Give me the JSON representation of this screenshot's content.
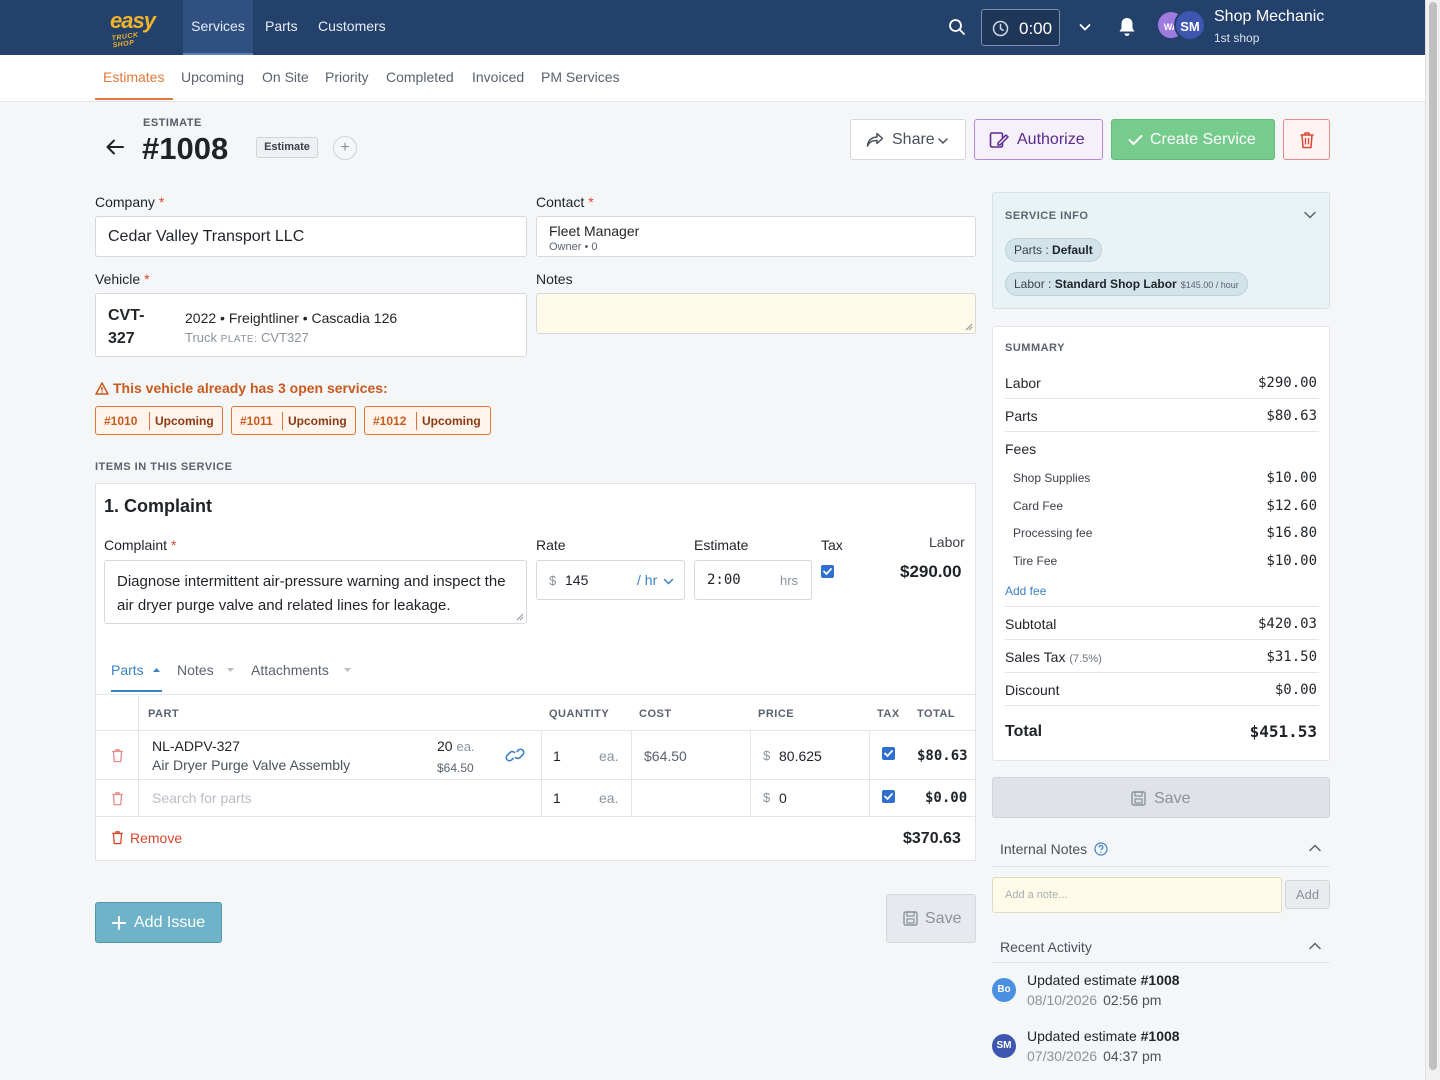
{
  "topnav": {
    "logo_line1": "easy",
    "logo_line2": "TRUCK SHOP",
    "tabs": [
      "Services",
      "Parts",
      "Customers"
    ],
    "timer": "0:00",
    "user": {
      "initials_a": "WA",
      "initials_b": "SM",
      "name": "Shop Mechanic",
      "shop": "1st shop"
    }
  },
  "subnav": {
    "tabs": [
      "Estimates",
      "Upcoming",
      "On Site",
      "Priority",
      "Completed",
      "Invoiced",
      "PM Services"
    ],
    "active": "Estimates"
  },
  "header": {
    "kicker": "ESTIMATE",
    "number": "#1008",
    "badge": "Estimate",
    "plus": "+",
    "share_label": "Share",
    "authorize_label": "Authorize",
    "create_label": "Create Service"
  },
  "form": {
    "company_label": "Company",
    "company_value": "Cedar Valley Transport LLC",
    "contact_label": "Contact",
    "contact_name": "Fleet Manager",
    "contact_sub": "Owner • 0",
    "vehicle_label": "Vehicle",
    "vehicle_id": "CVT-327",
    "vehicle_desc": "2022 • Freightliner • Cascadia 126",
    "vehicle_type": "Truck",
    "vehicle_plate_label": "PLATE:",
    "vehicle_plate": "CVT327",
    "notes_label": "Notes",
    "notes_value": "",
    "required_mark": "*"
  },
  "warning": {
    "text": "This vehicle already has 3 open services:",
    "services": [
      {
        "number": "#1010",
        "status": "Upcoming"
      },
      {
        "number": "#1011",
        "status": "Upcoming"
      },
      {
        "number": "#1012",
        "status": "Upcoming"
      }
    ]
  },
  "items": {
    "section_title": "ITEMS IN THIS SERVICE",
    "issue_title": "1. Complaint",
    "complaint_label": "Complaint",
    "complaint_text": "Diagnose intermittent air-pressure warning and inspect the air dryer purge valve and related lines for leakage.",
    "rate_label": "Rate",
    "rate_currency": "$",
    "rate_value": "145",
    "rate_unit": "/ hr",
    "estimate_label": "Estimate",
    "estimate_value": "2:00",
    "estimate_unit": "hrs",
    "tax_label": "Tax",
    "labor_label": "Labor",
    "labor_value": "$290.00",
    "subtabs": [
      "Parts",
      "Notes",
      "Attachments"
    ],
    "columns": [
      "PART",
      "QUANTITY",
      "COST",
      "PRICE",
      "TAX",
      "TOTAL"
    ],
    "parts": [
      {
        "part_number": "NL-ADPV-327",
        "description": "Air Dryer Purge Valve Assembly",
        "stock": "20",
        "stock_unit": "ea.",
        "stock_cost": "$64.50",
        "quantity": "1",
        "unit": "ea.",
        "cost": "$64.50",
        "price_currency": "$",
        "price": "80.625",
        "total": "$80.63"
      },
      {
        "part_number": "",
        "placeholder": "Search for parts",
        "quantity": "1",
        "unit": "ea.",
        "cost": "",
        "price_currency": "$",
        "price": "0",
        "total": "$0.00"
      }
    ],
    "remove_label": "Remove",
    "parts_total": "$370.63",
    "add_issue_label": "Add Issue",
    "save_label": "Save"
  },
  "service_info": {
    "title": "SERVICE INFO",
    "parts_key": "Parts",
    "parts_value": "Default",
    "labor_key": "Labor",
    "labor_value": "Standard Shop Labor",
    "labor_rate": "$145.00 / hour"
  },
  "summary": {
    "title": "SUMMARY",
    "labor_label": "Labor",
    "labor": "$290.00",
    "parts_label": "Parts",
    "parts": "$80.63",
    "fees_label": "Fees",
    "fees": [
      {
        "label": "Shop Supplies",
        "value": "$10.00"
      },
      {
        "label": "Card Fee",
        "value": "$12.60"
      },
      {
        "label": "Processing fee",
        "value": "$16.80"
      },
      {
        "label": "Tire Fee",
        "value": "$10.00"
      }
    ],
    "add_fee": "Add fee",
    "subtotal_label": "Subtotal",
    "subtotal": "$420.03",
    "tax_label": "Sales Tax",
    "tax_rate": "(7.5%)",
    "tax": "$31.50",
    "discount_label": "Discount",
    "discount": "$0.00",
    "total_label": "Total",
    "total": "$451.53",
    "save_label": "Save"
  },
  "internal_notes": {
    "title": "Internal Notes",
    "placeholder": "Add a note...",
    "add_label": "Add"
  },
  "activity": {
    "title": "Recent Activity",
    "entries": [
      {
        "initials": "Bo",
        "text": "Updated estimate ",
        "ref": "#1008",
        "date": "08/10/2026",
        "time": "02:56 pm"
      },
      {
        "initials": "SM",
        "text": "Updated estimate ",
        "ref": "#1008",
        "date": "07/30/2026",
        "time": "04:37 pm"
      }
    ]
  },
  "colors": {
    "nav": "#24416b",
    "accent_orange": "#e5793a",
    "link_blue": "#3b82c4",
    "authorize": "#b38ad6",
    "create": "#75cc8c",
    "danger": "#d9462e"
  }
}
